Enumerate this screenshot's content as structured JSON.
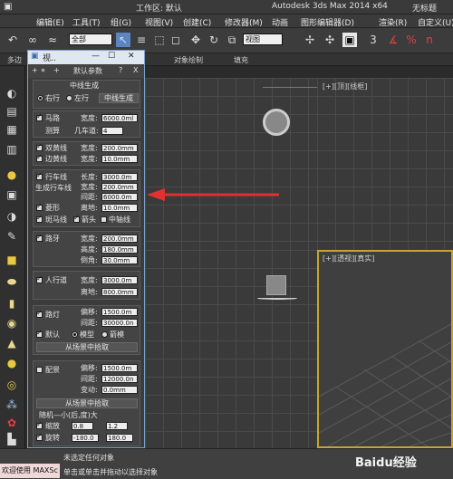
{
  "titlebar": {
    "workspace": "工作区: 默认",
    "app": "Autodesk 3ds Max  2014 x64",
    "doc": "无标题"
  },
  "menubar": {
    "items": [
      "编辑(E)",
      "工具(T)",
      "组(G)",
      "视图(V)",
      "创建(C)",
      "修改器(M)",
      "动画",
      "图形编辑器(D)",
      "渲染(R)",
      "自定义(U)"
    ],
    "partial_left": "修",
    "partial_right": "自定义(U)"
  },
  "toolbar": {
    "filter_value": "全部",
    "view_value": "视图",
    "snap_label": "3",
    "angle_label": "n"
  },
  "ribbon": {
    "left": "多边",
    "center": "对象绘制",
    "right": "填充"
  },
  "viewports": {
    "top_label": "[+][顶][线框]",
    "persp_label": "[+][透视][真实]"
  },
  "panel": {
    "title": "视..",
    "tabs": {
      "t1": "+",
      "t2": "⋄",
      "t3": "+",
      "title": "默认参数",
      "help": "?",
      "close": "X"
    },
    "center_group": {
      "heading": "中线生成",
      "right_label": "右行",
      "left_label": "左行",
      "gen_button": "中线生成"
    },
    "road": {
      "label": "马路",
      "width_label": "宽度:",
      "width_value": "6000.0ml",
      "lanes_label": "几车道:",
      "lanes_value": "4",
      "tag": "测算"
    },
    "double_yellow": {
      "label": "双黄线",
      "width_label": "宽度:",
      "width_value": "200.0mm"
    },
    "edge_yellow": {
      "label": "边黄线",
      "width_label": "宽度:",
      "width_value": "10.0mm"
    },
    "lane_line": {
      "label": "行车线",
      "gen_label": "生成行车线",
      "length_label": "长度:",
      "length_value": "3000.0m",
      "width_label": "宽度:",
      "width_value": "200.0mm",
      "gap_label": "间距:",
      "gap_value": "6000.0m",
      "diamond_label": "菱形",
      "offset_label": "离地:",
      "offset_value": "10.0mm",
      "zebra_label": "斑马线",
      "arrow_label": "箭头",
      "median_label": "中轴线"
    },
    "curb": {
      "label": "路牙",
      "width_label": "宽度:",
      "width_value": "200.0mm",
      "height_label": "高度:",
      "height_value": "180.0mm",
      "chamfer_label": "倒角:",
      "chamfer_value": "30.0mm"
    },
    "sidewalk": {
      "label": "人行道",
      "width_label": "宽度:",
      "width_value": "3000.0m",
      "offset_label": "离地:",
      "offset_value": "800.0mm"
    },
    "street_light": {
      "label": "路灯",
      "offset_label": "偏移:",
      "offset_value": "1500.0m",
      "spacing_label": "间距:",
      "spacing_value": "30000.0n",
      "default_label": "默认",
      "model_label": "模型",
      "box_label": "箭模",
      "pick_button": "从场景中拾取"
    },
    "scenery": {
      "label": "配景",
      "offset_label": "偏移:",
      "offset_value": "1500.0m",
      "spacing_label": "间距:",
      "spacing_value": "12000.0n",
      "variation_label": "变动:",
      "variation_value": "0.0mm",
      "pick_button": "从场景中拾取",
      "random_heading": "随机—小(后,度)大",
      "scale_label": "缩放",
      "scale_min": "0.8",
      "scale_max": "1.2",
      "rotate_label": "旋转",
      "rotate_min": "-180.0",
      "rotate_max": "180.0"
    }
  },
  "statusbar": {
    "welcome": "欢迎使用 MAXSc",
    "status1": "未选定任何对象",
    "status2": "单击或单击并拖动以选择对象",
    "watermark": "Baidu经验"
  },
  "colors": {
    "arrow": "#e03030",
    "accent": "#c8a434"
  }
}
